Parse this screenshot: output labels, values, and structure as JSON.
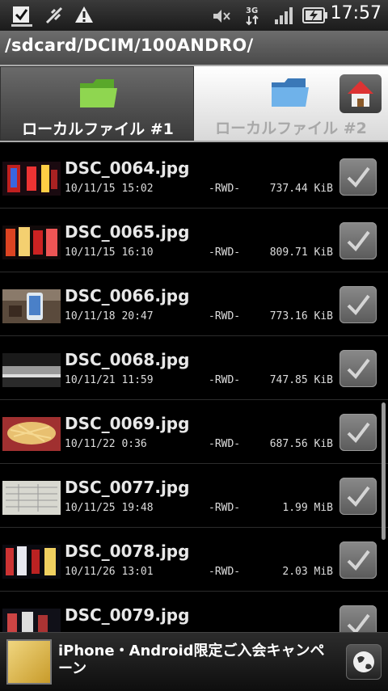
{
  "status_bar": {
    "time": "17:57",
    "icons": [
      "download-complete-icon",
      "usb-debug-icon",
      "warning-icon",
      "mute-icon",
      "3g-icon",
      "signal-icon",
      "battery-charging-icon"
    ]
  },
  "path": "/sdcard/DCIM/100ANDRO/",
  "tabs": [
    {
      "label": "ローカルファイル #1",
      "icon": "green-folder-icon",
      "active": true
    },
    {
      "label": "ローカルファイル #2",
      "icon": "blue-folder-icon",
      "active": false
    }
  ],
  "home_button_icon": "home-icon",
  "files": [
    {
      "name": "DSC_0064.jpg",
      "date": "10/11/15 15:02",
      "attr": "-RWD-",
      "size": "737.44 KiB"
    },
    {
      "name": "DSC_0065.jpg",
      "date": "10/11/15 16:10",
      "attr": "-RWD-",
      "size": "809.71 KiB"
    },
    {
      "name": "DSC_0066.jpg",
      "date": "10/11/18 20:47",
      "attr": "-RWD-",
      "size": "773.16 KiB"
    },
    {
      "name": "DSC_0068.jpg",
      "date": "10/11/21 11:59",
      "attr": "-RWD-",
      "size": "747.85 KiB"
    },
    {
      "name": "DSC_0069.jpg",
      "date": "10/11/22 0:36",
      "attr": "-RWD-",
      "size": "687.56 KiB"
    },
    {
      "name": "DSC_0077.jpg",
      "date": "10/11/25 19:48",
      "attr": "-RWD-",
      "size": "1.99 MiB"
    },
    {
      "name": "DSC_0078.jpg",
      "date": "10/11/26 13:01",
      "attr": "-RWD-",
      "size": "2.03 MiB"
    },
    {
      "name": "DSC_0079.jpg",
      "date": "",
      "attr": "",
      "size": ""
    }
  ],
  "ad": {
    "text": "iPhone・Android限定ご入会キャンペーン",
    "button_icon": "globe-icon"
  }
}
